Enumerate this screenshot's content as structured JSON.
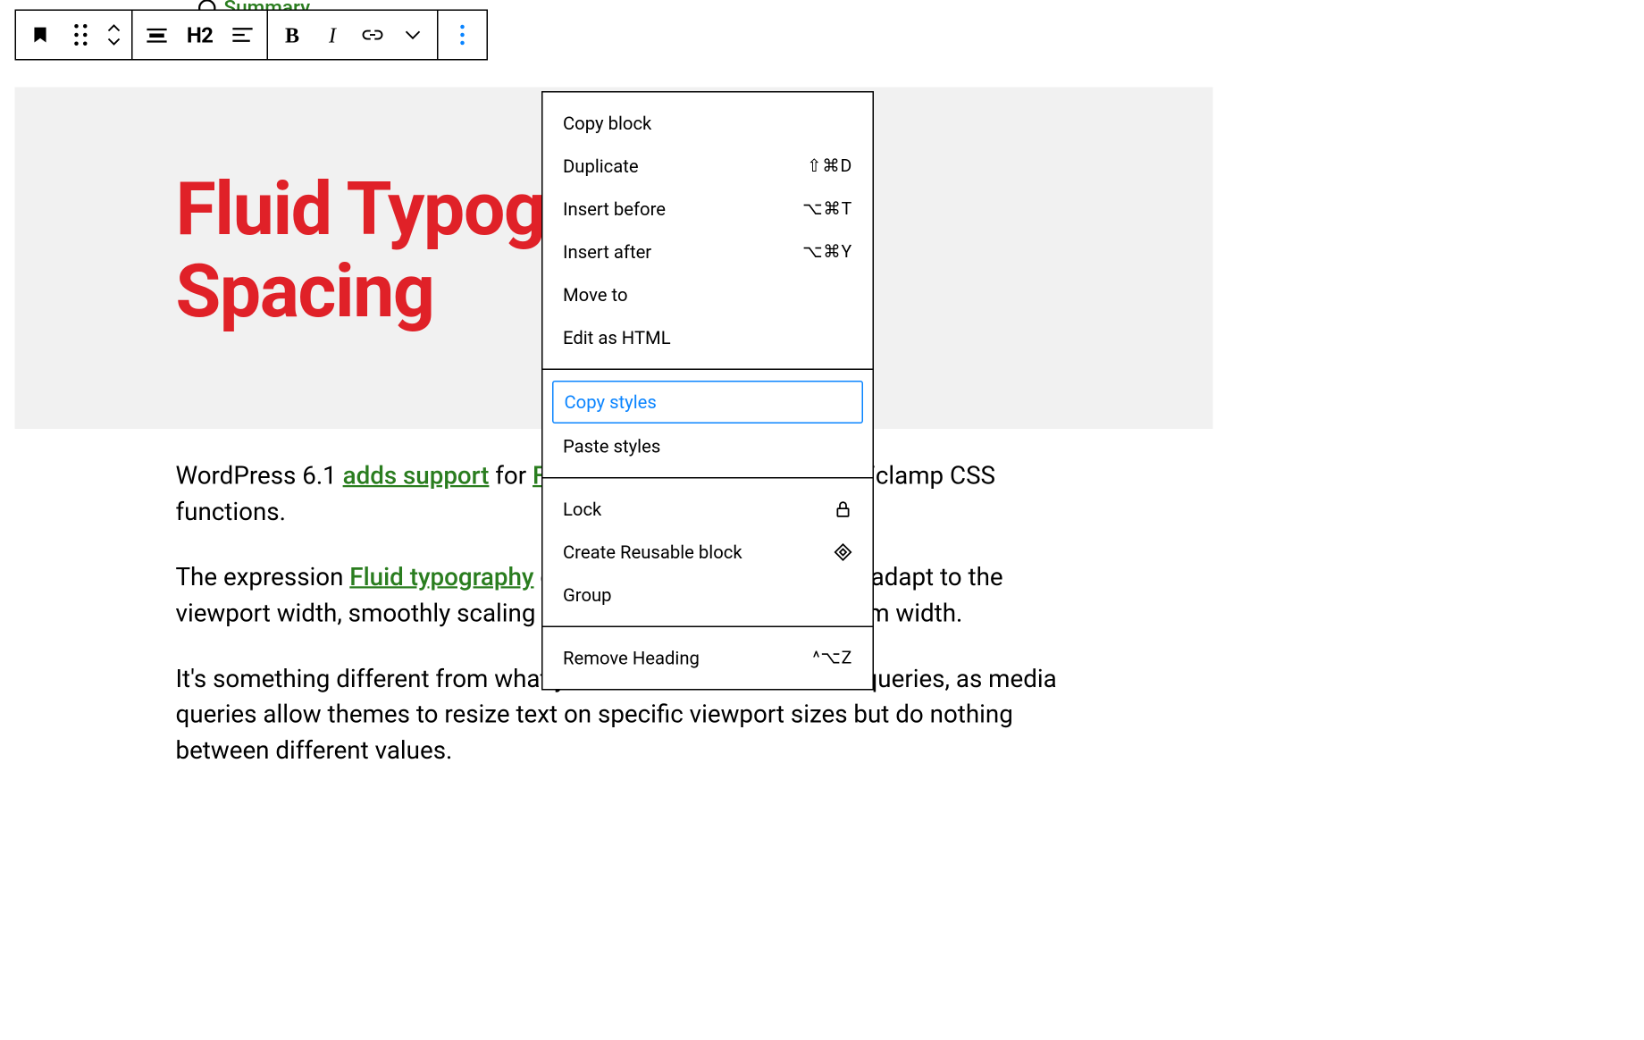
{
  "summary_link": "Summary",
  "toolbar": {
    "heading_level": "H2"
  },
  "heading": "Fluid Typography and Spacing",
  "paragraphs": {
    "p1_pre": "WordPress 6.1 ",
    "p1_link1": "adds support",
    "p1_mid": " for ",
    "p1_link2": "Fluid Typography",
    "p1_post": " through calc/clamp CSS functions.",
    "p2_pre": "The expression ",
    "p2_link": "Fluid typography",
    "p2_post": " describes the ability of text to adapt to the viewport width, smoothly scaling from a minimum to a maximum width.",
    "p3": "It's something different from what you can achieve with media queries, as media queries allow themes to resize text on specific viewport sizes but do nothing between different values."
  },
  "menu": {
    "copy_block": "Copy block",
    "duplicate": {
      "label": "Duplicate",
      "shortcut": "⇧⌘D"
    },
    "insert_before": {
      "label": "Insert before",
      "shortcut": "⌥⌘T"
    },
    "insert_after": {
      "label": "Insert after",
      "shortcut": "⌥⌘Y"
    },
    "move_to": "Move to",
    "edit_html": "Edit as HTML",
    "copy_styles": "Copy styles",
    "paste_styles": "Paste styles",
    "lock": "Lock",
    "create_reusable": "Create Reusable block",
    "group": "Group",
    "remove": {
      "label": "Remove Heading",
      "shortcut": "^⌥Z"
    }
  }
}
